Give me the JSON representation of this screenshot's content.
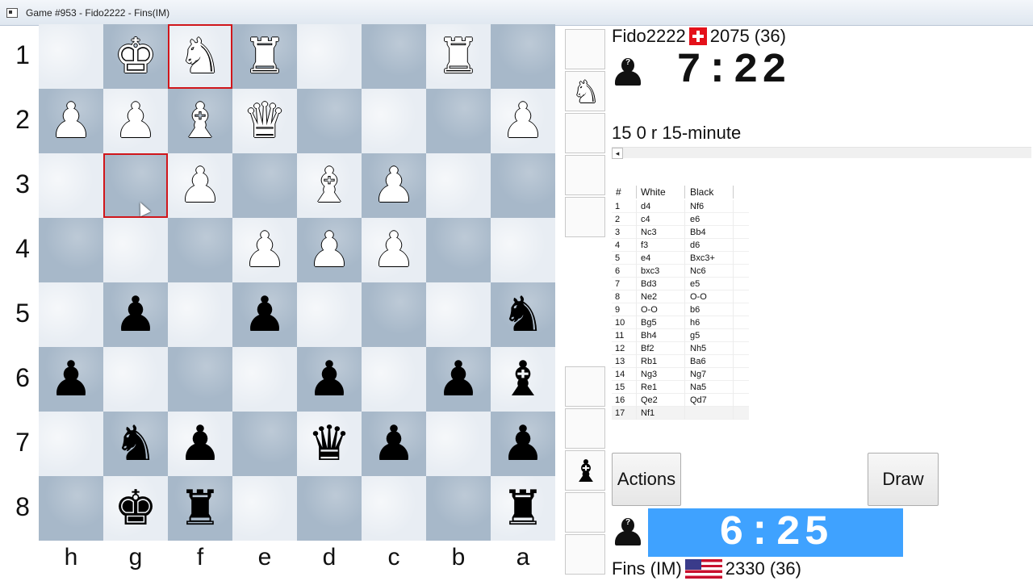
{
  "window": {
    "title": "Game #953 - Fido2222 - Fins(IM)"
  },
  "board": {
    "ranks": [
      "1",
      "2",
      "3",
      "4",
      "5",
      "6",
      "7",
      "8"
    ],
    "files": [
      "h",
      "g",
      "f",
      "e",
      "d",
      "c",
      "b",
      "a"
    ],
    "pieces": [
      {
        "sq": "g1",
        "glyph": "♚",
        "color": "w"
      },
      {
        "sq": "f1",
        "glyph": "♞",
        "color": "w"
      },
      {
        "sq": "e1",
        "glyph": "♜",
        "color": "w"
      },
      {
        "sq": "b1",
        "glyph": "♜",
        "color": "w"
      },
      {
        "sq": "h2",
        "glyph": "♟",
        "color": "w"
      },
      {
        "sq": "g2",
        "glyph": "♟",
        "color": "w"
      },
      {
        "sq": "f2",
        "glyph": "♝",
        "color": "w"
      },
      {
        "sq": "e2",
        "glyph": "♛",
        "color": "w"
      },
      {
        "sq": "a2",
        "glyph": "♟",
        "color": "w"
      },
      {
        "sq": "f3",
        "glyph": "♟",
        "color": "w"
      },
      {
        "sq": "d3",
        "glyph": "♝",
        "color": "w"
      },
      {
        "sq": "c3",
        "glyph": "♟",
        "color": "w"
      },
      {
        "sq": "e4",
        "glyph": "♟",
        "color": "w"
      },
      {
        "sq": "d4",
        "glyph": "♟",
        "color": "w"
      },
      {
        "sq": "c4",
        "glyph": "♟",
        "color": "w"
      },
      {
        "sq": "g5",
        "glyph": "♟",
        "color": "b"
      },
      {
        "sq": "e5",
        "glyph": "♟",
        "color": "b"
      },
      {
        "sq": "a5",
        "glyph": "♞",
        "color": "b"
      },
      {
        "sq": "h6",
        "glyph": "♟",
        "color": "b"
      },
      {
        "sq": "d6",
        "glyph": "♟",
        "color": "b"
      },
      {
        "sq": "b6",
        "glyph": "♟",
        "color": "b"
      },
      {
        "sq": "a6",
        "glyph": "♝",
        "color": "b"
      },
      {
        "sq": "g7",
        "glyph": "♞",
        "color": "b"
      },
      {
        "sq": "f7",
        "glyph": "♟",
        "color": "b"
      },
      {
        "sq": "d7",
        "glyph": "♛",
        "color": "b"
      },
      {
        "sq": "c7",
        "glyph": "♟",
        "color": "b"
      },
      {
        "sq": "a7",
        "glyph": "♟",
        "color": "b"
      },
      {
        "sq": "g8",
        "glyph": "♚",
        "color": "b"
      },
      {
        "sq": "f8",
        "glyph": "♜",
        "color": "b"
      },
      {
        "sq": "a8",
        "glyph": "♜",
        "color": "b"
      }
    ],
    "highlighted": [
      "f1",
      "g3"
    ],
    "highlight_color": "#d0161b",
    "light_color": "#e8edf3",
    "dark_color": "#a7b8c9"
  },
  "captured": {
    "top": [
      {
        "glyph": "♞",
        "color": "w"
      }
    ],
    "bottom": [
      {
        "glyph": "♝",
        "color": "b"
      }
    ]
  },
  "opponent": {
    "name": "Fido2222",
    "flag": "switzerland-flag-icon",
    "rating": "2075 (36)",
    "clock": "7:22"
  },
  "player": {
    "name": "Fins (IM)",
    "flag": "usa-flag-icon",
    "rating": "2330 (36)",
    "clock": "6:25",
    "clock_color": "#3fa2ff"
  },
  "game_info": "15 0 r 15-minute",
  "scroll_left": "◂",
  "movelist": {
    "headers": {
      "num": "#",
      "white": "White",
      "black": "Black"
    },
    "moves": [
      {
        "n": "1",
        "w": "d4",
        "b": "Nf6"
      },
      {
        "n": "2",
        "w": "c4",
        "b": "e6"
      },
      {
        "n": "3",
        "w": "Nc3",
        "b": "Bb4"
      },
      {
        "n": "4",
        "w": "f3",
        "b": "d6"
      },
      {
        "n": "5",
        "w": "e4",
        "b": "Bxc3+"
      },
      {
        "n": "6",
        "w": "bxc3",
        "b": "Nc6"
      },
      {
        "n": "7",
        "w": "Bd3",
        "b": "e5"
      },
      {
        "n": "8",
        "w": "Ne2",
        "b": "O-O"
      },
      {
        "n": "9",
        "w": "O-O",
        "b": "b6"
      },
      {
        "n": "10",
        "w": "Bg5",
        "b": "h6"
      },
      {
        "n": "11",
        "w": "Bh4",
        "b": "g5"
      },
      {
        "n": "12",
        "w": "Bf2",
        "b": "Nh5"
      },
      {
        "n": "13",
        "w": "Rb1",
        "b": "Ba6"
      },
      {
        "n": "14",
        "w": "Ng3",
        "b": "Ng7"
      },
      {
        "n": "15",
        "w": "Re1",
        "b": "Na5"
      },
      {
        "n": "16",
        "w": "Qe2",
        "b": "Qd7"
      },
      {
        "n": "17",
        "w": "Nf1",
        "b": ""
      }
    ]
  },
  "buttons": {
    "actions": "Actions",
    "draw": "Draw"
  }
}
